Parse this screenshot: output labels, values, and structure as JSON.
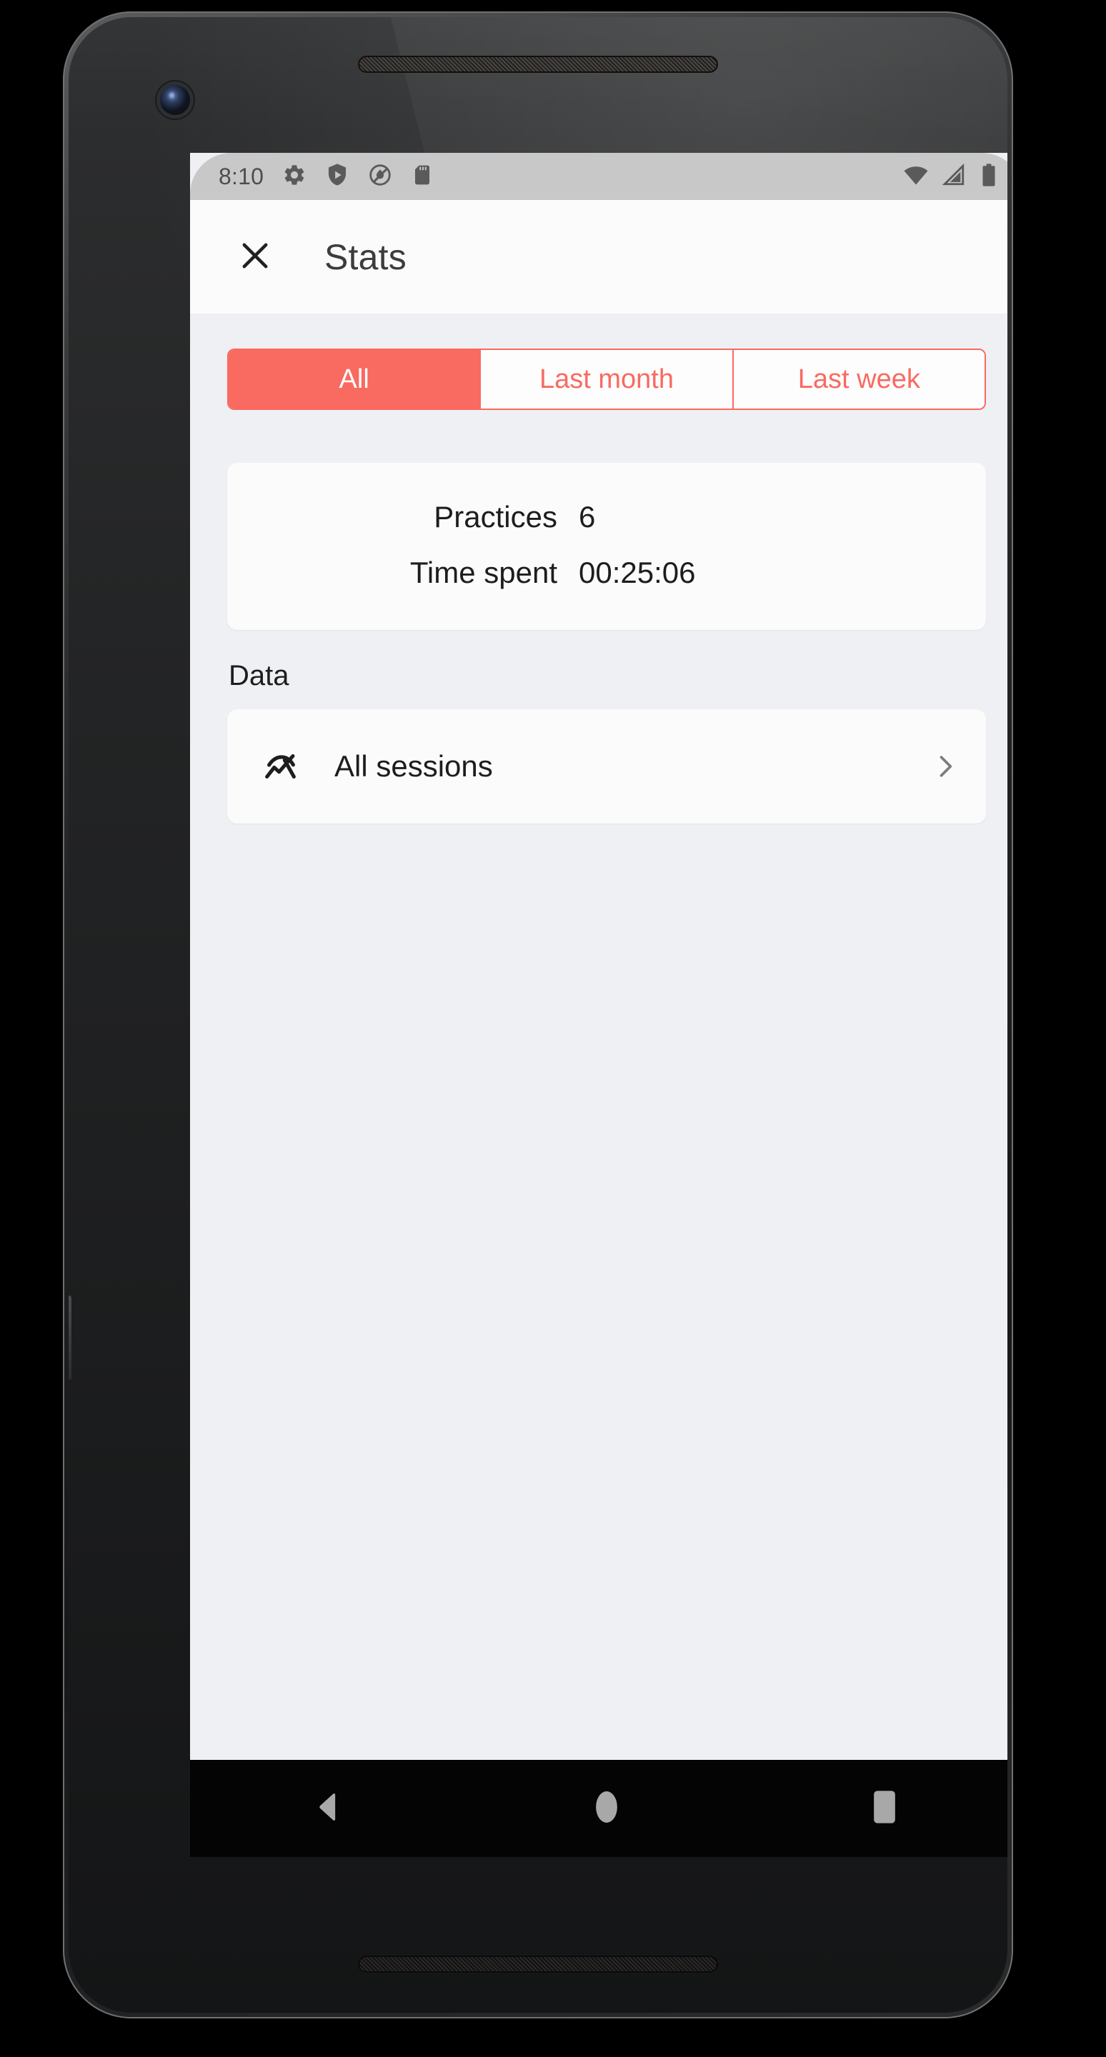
{
  "device": {
    "name": "android-phone",
    "speaker_top": "speaker-grille-top",
    "speaker_bottom": "speaker-grille-bottom",
    "front_camera": "front-camera-lens"
  },
  "status_bar": {
    "clock": "8:10",
    "left_icons": [
      "gear-icon",
      "play-protect-shield-icon",
      "do-not-disturb-icon",
      "sd-card-icon"
    ],
    "right_icons": [
      "wifi-icon",
      "cellular-signal-icon",
      "battery-icon"
    ],
    "background_color": "#c8c8c8",
    "icon_color": "#5a5a5a"
  },
  "app_bar": {
    "close_icon": "close-icon",
    "title": "Stats",
    "background_color": "#fbfbfb"
  },
  "segmented_control": {
    "accent_color": "#f96a61",
    "selected_index": 0,
    "segments": [
      {
        "label": "All",
        "selected": true
      },
      {
        "label": "Last month",
        "selected": false
      },
      {
        "label": "Last week",
        "selected": false
      }
    ]
  },
  "summary_card": {
    "rows": [
      {
        "label": "Practices",
        "value": "6"
      },
      {
        "label": "Time spent",
        "value": "00:25:06"
      }
    ]
  },
  "data_section": {
    "title": "Data",
    "items": [
      {
        "icon": "show-chart-icon",
        "label": "All sessions",
        "trailing_icon": "chevron-right-icon"
      }
    ]
  },
  "nav_bar": {
    "background_color": "#040404",
    "buttons": [
      {
        "name": "back-button",
        "icon": "back-triangle-icon"
      },
      {
        "name": "home-button",
        "icon": "home-circle-icon"
      },
      {
        "name": "recents-button",
        "icon": "recents-square-icon"
      }
    ]
  },
  "colors": {
    "screen_background": "#eff0f3",
    "card_background": "#fbfbfb",
    "text_primary": "#1d1d1d",
    "accent": "#f96a61"
  }
}
